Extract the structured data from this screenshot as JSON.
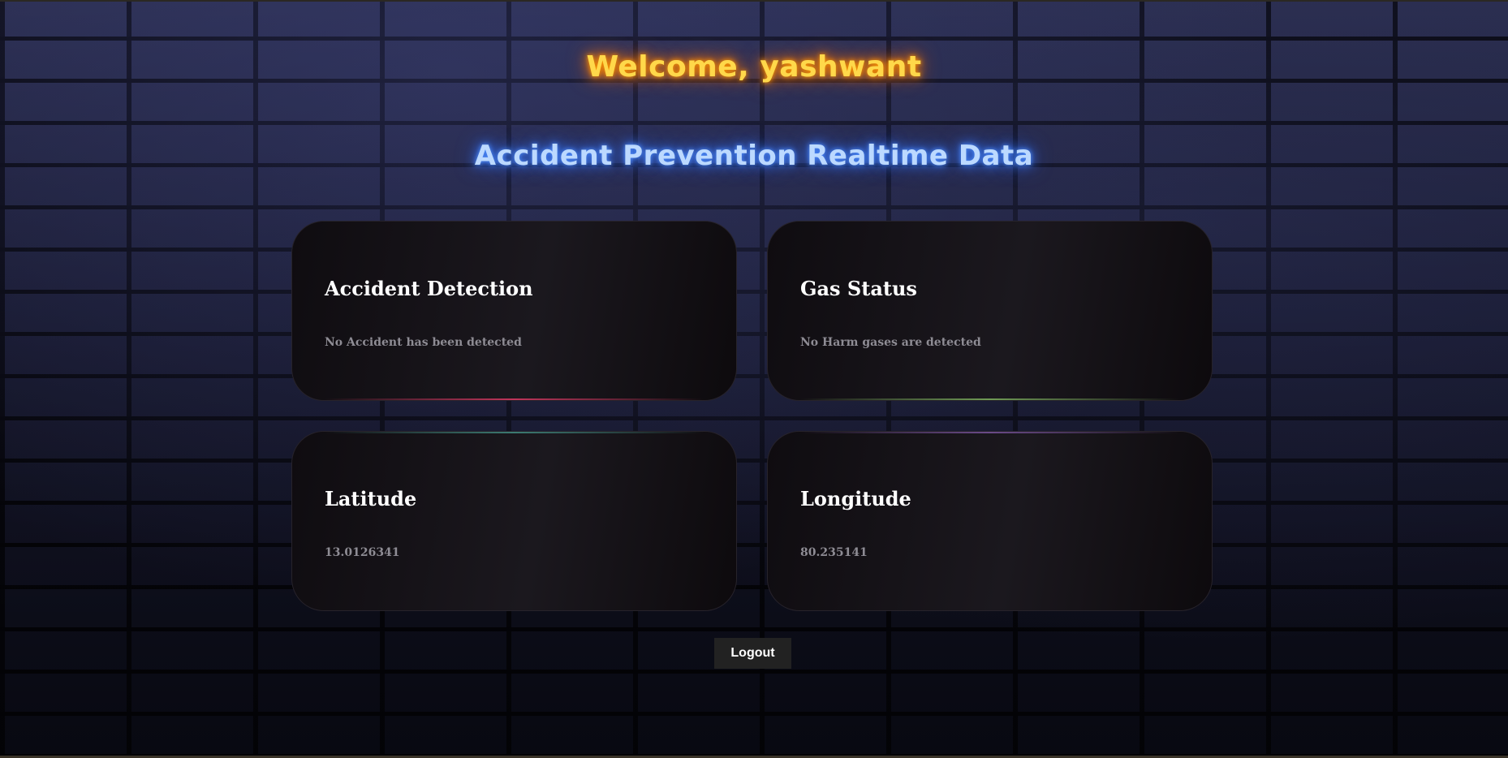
{
  "header": {
    "welcome": "Welcome, yashwant",
    "subtitle": "Accident Prevention Realtime Data"
  },
  "cards": [
    {
      "title": "Accident Detection",
      "value": "No Accident has been detected"
    },
    {
      "title": "Gas Status",
      "value": "No Harm gases are detected"
    },
    {
      "title": "Latitude",
      "value": "13.0126341"
    },
    {
      "title": "Longitude",
      "value": "80.235141"
    }
  ],
  "actions": {
    "logout_label": "Logout"
  },
  "colors": {
    "welcome_glow": "#ff9a00",
    "subtitle_glow": "#4f8fff",
    "card_background": "#15121a",
    "button_background": "#222222"
  }
}
